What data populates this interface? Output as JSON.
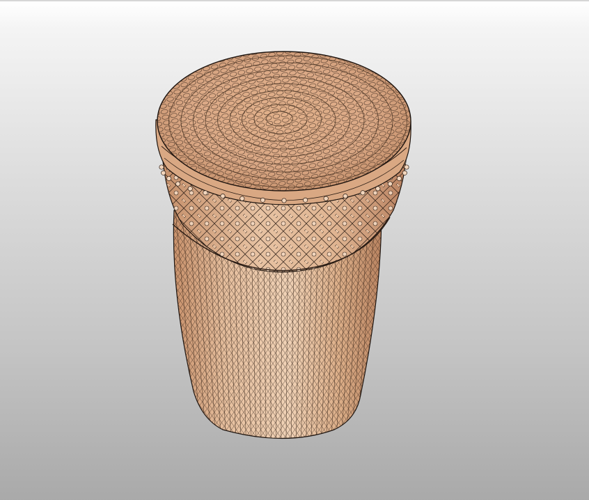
{
  "viewport": {
    "background_top": "#ffffff",
    "background_bottom": "#a9a9a9"
  },
  "model": {
    "icon": "woven-basket-3d-model",
    "colors": {
      "wicker_light": "#e9c4a4",
      "wicker_mid": "#d7a57f",
      "wicker_dark": "#b37b57",
      "edge_lines": "#1a1a1a"
    }
  }
}
